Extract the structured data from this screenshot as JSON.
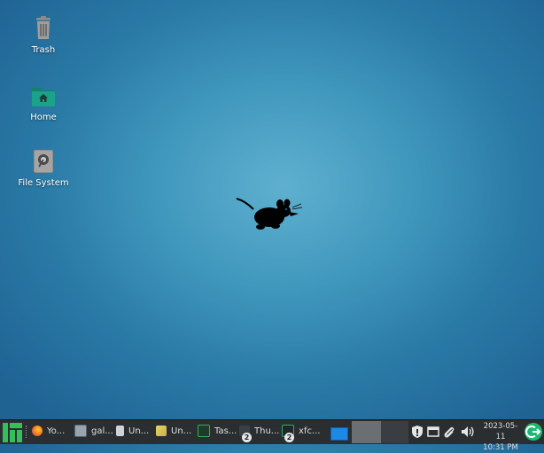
{
  "desktop": {
    "icons": [
      {
        "label": "Trash",
        "icon": "trash-icon"
      },
      {
        "label": "Home",
        "icon": "home-folder-icon"
      },
      {
        "label": "File System",
        "icon": "hard-drive-icon"
      }
    ],
    "wallpaper_icon": "xfce-mouse-logo"
  },
  "taskbar": {
    "tasks": [
      {
        "label": "Yo...",
        "icon": "firefox-icon"
      },
      {
        "label": "gal...",
        "icon": "calculator-icon"
      },
      {
        "label": "Un...",
        "icon": "document-icon"
      },
      {
        "label": "Un...",
        "icon": "text-editor-icon"
      },
      {
        "label": "Tas...",
        "icon": "task-manager-icon"
      },
      {
        "label": "Thu...",
        "icon": "folder-icon",
        "badge": "2"
      },
      {
        "label": "xfc...",
        "icon": "terminal-icon",
        "badge": "2"
      }
    ],
    "clock": {
      "date": "2023-05-11",
      "time": "10:31 PM"
    }
  },
  "colors": {
    "panel_bg": "#2b2e31",
    "manjaro_green": "#35bf5c",
    "folder_teal": "#1aa38a",
    "active_workspace": "#1e88e5",
    "power_green": "#1fb873"
  }
}
